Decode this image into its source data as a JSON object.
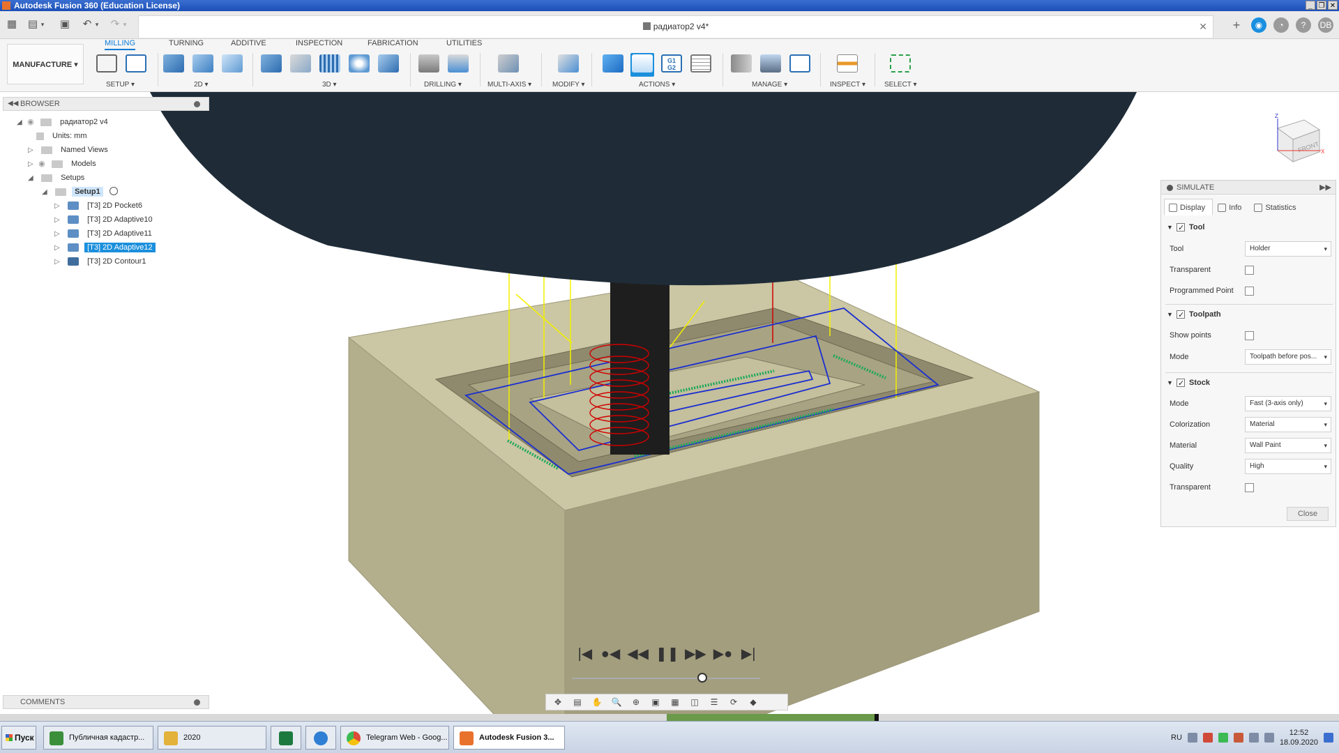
{
  "window": {
    "title": "Autodesk Fusion 360 (Education License)",
    "min_label": "_",
    "max_label": "❐",
    "close_label": "✕"
  },
  "document": {
    "title": "радиатор2 v4*",
    "close_label": "✕"
  },
  "quick_access": {
    "user_initials": "DB"
  },
  "toolbar": {
    "workspace_label": "MANUFACTURE ▾",
    "tabs": [
      {
        "label": "MILLING",
        "active": true
      },
      {
        "label": "TURNING"
      },
      {
        "label": "ADDITIVE"
      },
      {
        "label": "INSPECTION"
      },
      {
        "label": "FABRICATION"
      },
      {
        "label": "UTILITIES"
      }
    ],
    "groups": {
      "setup": "SETUP ▾",
      "twod": "2D ▾",
      "threed": "3D ▾",
      "drilling": "DRILLING ▾",
      "multiaxis": "MULTI-AXIS ▾",
      "modify": "MODIFY ▾",
      "actions": "ACTIONS ▾",
      "manage": "MANAGE ▾",
      "inspect": "INSPECT ▾",
      "select": "SELECT ▾"
    },
    "g1g2_label": "G1\nG2"
  },
  "browser": {
    "header": "BROWSER",
    "root": "радиатор2 v4",
    "units": "Units: mm",
    "named_views": "Named Views",
    "models": "Models",
    "setups": "Setups",
    "setup1": "Setup1",
    "operations": [
      {
        "label": "[T3] 2D Pocket6",
        "selected": false
      },
      {
        "label": "[T3] 2D Adaptive10",
        "selected": false
      },
      {
        "label": "[T3] 2D Adaptive11",
        "selected": false
      },
      {
        "label": "[T3] 2D Adaptive12",
        "selected": true
      },
      {
        "label": "[T3] 2D Contour1",
        "selected": false
      }
    ]
  },
  "comments": {
    "header": "COMMENTS"
  },
  "viewcube": {
    "face_label": "FRONT",
    "x_label": "X",
    "z_label": "Z"
  },
  "simulate": {
    "header": "SIMULATE",
    "tabs": [
      "Display",
      "Info",
      "Statistics"
    ],
    "tool_section": "Tool",
    "tool_label": "Tool",
    "tool_value": "Holder",
    "transparent_label": "Transparent",
    "programmed_point_label": "Programmed Point",
    "toolpath_section": "Toolpath",
    "show_points_label": "Show points",
    "mode_label": "Mode",
    "toolpath_mode_value": "Toolpath before pos...",
    "stock_section": "Stock",
    "stock_mode_value": "Fast (3-axis only)",
    "colorization_label": "Colorization",
    "colorization_value": "Material",
    "material_label": "Material",
    "material_value": "Wall Paint",
    "quality_label": "Quality",
    "quality_value": "High",
    "stock_transparent_label": "Transparent",
    "close_label": "Close"
  },
  "playback": {
    "first": "|◀",
    "prev_op": "●◀",
    "rewind": "◀◀",
    "pause": "❚❚",
    "forward": "▶▶",
    "next_op": "▶●",
    "last": "▶|"
  },
  "taskbar": {
    "start_label": "Пуск",
    "tasks": [
      {
        "label": "Публичная кадастр...",
        "color": "#3b8f3b"
      },
      {
        "label": "2020",
        "color": "#e2b23a"
      },
      {
        "label": "",
        "color": "#1d7a3e"
      },
      {
        "label": "",
        "color": "#2f7fd4"
      },
      {
        "label": "Telegram Web - Goog...",
        "color": "#dd4b39"
      },
      {
        "label": "Autodesk Fusion 3...",
        "color": "#e8722c",
        "active": true
      }
    ],
    "lang": "RU",
    "time": "12:52",
    "date": "18.09.2020"
  },
  "colors": {
    "accent": "#1b8fdc",
    "stock": "#c8c3a2",
    "holder": "#1f2c38",
    "toolpath_blue": "#1a2fd0",
    "toolpath_yellow": "#f2f000",
    "toolpath_red": "#d00000",
    "toolpath_green": "#1aa85a"
  }
}
